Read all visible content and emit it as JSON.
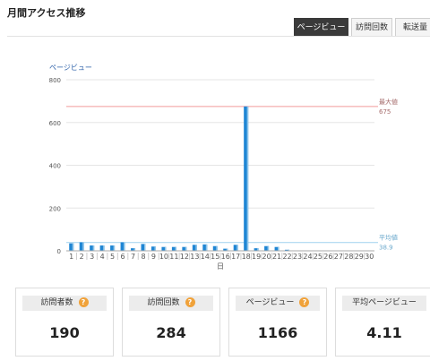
{
  "page": {
    "title": "月間アクセス推移"
  },
  "tabs": [
    {
      "label": "ページビュー",
      "active": true
    },
    {
      "label": "訪問回数",
      "active": false
    },
    {
      "label": "転送量",
      "active": false
    }
  ],
  "chart_data": {
    "type": "bar",
    "series_label": "ページビュー",
    "xlabel": "日",
    "ylim": [
      0,
      800
    ],
    "yticks": [
      0,
      200,
      400,
      600,
      800
    ],
    "categories": [
      "1",
      "2",
      "3",
      "4",
      "5",
      "6",
      "7",
      "8",
      "9",
      "10",
      "11",
      "12",
      "13",
      "14",
      "15",
      "16",
      "17",
      "18",
      "19",
      "20",
      "21",
      "22",
      "23",
      "24",
      "25",
      "26",
      "27",
      "28",
      "29",
      "30"
    ],
    "values": [
      35,
      40,
      25,
      25,
      25,
      40,
      12,
      32,
      20,
      18,
      18,
      18,
      28,
      30,
      22,
      10,
      28,
      675,
      12,
      22,
      18,
      5,
      0,
      0,
      0,
      0,
      0,
      0,
      0,
      0
    ],
    "reference_lines": [
      {
        "name": "最大値",
        "value": 675,
        "value_label": "675",
        "color": "#f19a9a",
        "label_color": "#a66d6d"
      },
      {
        "name": "平均値",
        "value": 38.9,
        "value_label": "38.9",
        "color": "#9fd2ef",
        "label_color": "#6aa8cc"
      }
    ],
    "colors": {
      "bar": "#1f86d4",
      "bar_light": "#8fc6ea",
      "axis": "#aaaaaa",
      "grid": "#e6e6e6",
      "label": "#555555"
    },
    "grid": true
  },
  "cards": [
    {
      "label": "訪問者数",
      "value": "190",
      "help": true,
      "help_icon": "?"
    },
    {
      "label": "訪問回数",
      "value": "284",
      "help": true,
      "help_icon": "?"
    },
    {
      "label": "ページビュー",
      "value": "1166",
      "help": true,
      "help_icon": "?"
    },
    {
      "label": "平均ページビュー",
      "value": "4.11",
      "help": false
    }
  ]
}
